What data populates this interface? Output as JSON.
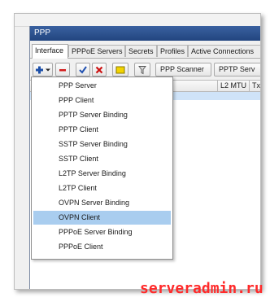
{
  "window": {
    "title": "PPP"
  },
  "tabs": [
    {
      "label": "Interface",
      "active": true
    },
    {
      "label": "PPPoE Servers"
    },
    {
      "label": "Secrets"
    },
    {
      "label": "Profiles"
    },
    {
      "label": "Active Connections"
    }
  ],
  "toolbar": {
    "buttons": [
      {
        "name": "add-dropdown-button",
        "icon": "plus-icon",
        "color": "#1c4fa8"
      },
      {
        "name": "remove-button",
        "icon": "minus-icon",
        "color": "#d21a1a"
      },
      {
        "name": "enable-button",
        "icon": "checkmark-icon",
        "color": "#2050b0"
      },
      {
        "name": "disable-button",
        "icon": "x-icon",
        "color": "#cc1111"
      },
      {
        "name": "comment-button",
        "icon": "note-icon",
        "color": "#f2d300"
      },
      {
        "name": "filter-button",
        "icon": "filter-icon",
        "color": "#666666"
      }
    ],
    "ppp_scanner_label": "PPP Scanner",
    "pptp_server_label": "PPTP Serv"
  },
  "grid": {
    "columns": [
      {
        "label": "L2 MTU"
      },
      {
        "label": "Tx"
      }
    ]
  },
  "add_menu": {
    "items": [
      {
        "label": "PPP Server"
      },
      {
        "label": "PPP Client"
      },
      {
        "label": "PPTP Server Binding"
      },
      {
        "label": "PPTP Client"
      },
      {
        "label": "SSTP Server Binding"
      },
      {
        "label": "SSTP Client"
      },
      {
        "label": "L2TP Server Binding"
      },
      {
        "label": "L2TP Client"
      },
      {
        "label": "OVPN Server Binding"
      },
      {
        "label": "OVPN Client",
        "highlighted": true
      },
      {
        "label": "PPPoE Server Binding"
      },
      {
        "label": "PPPoE Client"
      }
    ]
  },
  "watermark": "serveradmin.ru",
  "colors": {
    "accent": "#22457f",
    "highlight": "#a9cdef",
    "watermark": "#ff2a2a"
  }
}
